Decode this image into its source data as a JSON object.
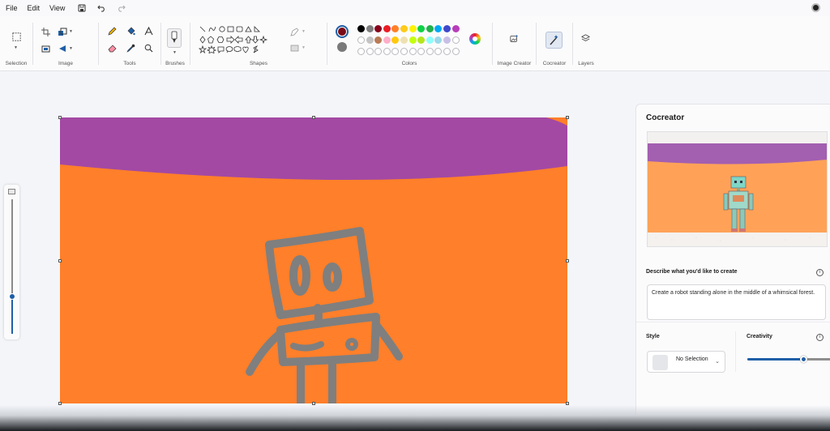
{
  "menu": {
    "file": "File",
    "edit": "Edit",
    "view": "View",
    "quick_icons": [
      "save-icon",
      "undo-icon",
      "redo-icon"
    ]
  },
  "ribbon": {
    "groups": {
      "selection": "Selection",
      "image": "Image",
      "tools": "Tools",
      "brushes": "Brushes",
      "shapes": "Shapes",
      "colors": "Colors",
      "image_creator": "Image Creator",
      "cocreator": "Cocreator",
      "layers": "Layers"
    }
  },
  "colors": {
    "primary": "#7a0c18",
    "secondary": "#7a7a7a",
    "palette_row1": [
      "#000000",
      "#7f7f7f",
      "#88001b",
      "#ec1c24",
      "#ff7f27",
      "#ffca18",
      "#fff200",
      "#0ed145",
      "#22b14c",
      "#00a8f3",
      "#3f48cc",
      "#b83dba"
    ],
    "palette_row2": [
      "#ffffff",
      "#c3c3c3",
      "#b97a56",
      "#ffaec8",
      "#ffc90e",
      "#eee0b1",
      "#c4ff0e",
      "#b5e61d",
      "#8cfffb",
      "#99d9ea",
      "#c8bfe7",
      "#ffffff"
    ],
    "canvas_background": "#ff7f2a",
    "sky_color": "#a349a4",
    "robot_stroke": "#7f7f7f"
  },
  "zoom": {
    "level": 0.27
  },
  "cocreator": {
    "title": "Cocreator",
    "describe_label": "Describe what you'd like to create",
    "prompt_text": "Create a robot standing alone in the middle of a whimsical forest.",
    "style_label": "Style",
    "style_value": "No Selection",
    "creativity_label": "Creativity",
    "creativity_level": 0.67
  }
}
